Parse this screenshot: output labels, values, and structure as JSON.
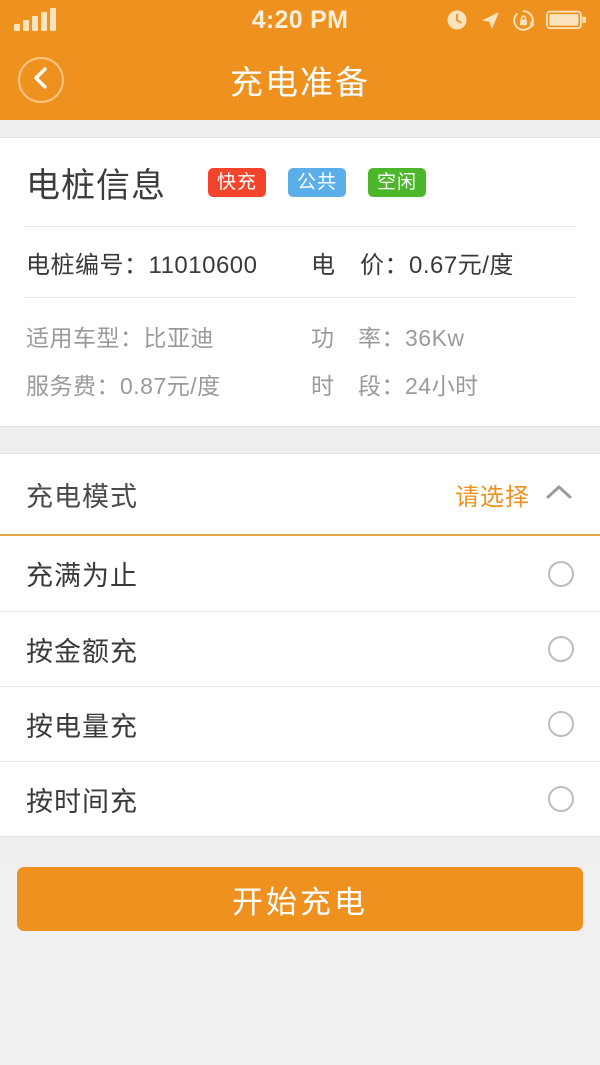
{
  "status_bar": {
    "time": "4:20 PM",
    "signal_icon": "signal-bars-icon",
    "alarm_icon": "alarm-clock-icon",
    "location_icon": "location-arrow-icon",
    "rotation_lock_icon": "rotation-lock-icon",
    "battery_icon": "battery-icon"
  },
  "nav": {
    "back_icon": "chevron-left-icon",
    "title": "充电准备"
  },
  "card": {
    "title": "电桩信息",
    "tags": [
      {
        "label": "快充",
        "color": "#f4452c"
      },
      {
        "label": "公共",
        "color": "#5aaeea"
      },
      {
        "label": "空闲",
        "color": "#4cb72a"
      }
    ],
    "primary_rows": [
      {
        "left": "电桩编号：11010600",
        "right": "电　价：0.67元/度"
      }
    ],
    "secondary_rows": [
      {
        "left": "适用车型：比亚迪",
        "right": "功　率：36Kw"
      },
      {
        "left": "服务费：0.87元/度",
        "right": "时　段：24小时"
      }
    ]
  },
  "mode_section": {
    "label": "充电模式",
    "value": "请选择",
    "chevron_icon": "chevron-up-icon",
    "options": [
      {
        "label": "充满为止",
        "selected": false
      },
      {
        "label": "按金额充",
        "selected": false
      },
      {
        "label": "按电量充",
        "selected": false
      },
      {
        "label": "按时间充",
        "selected": false
      }
    ]
  },
  "action": {
    "start_label": "开始充电"
  },
  "theme": {
    "accent": "#ef911e",
    "page_bg": "#f0f0f0",
    "card_bg": "#ffffff"
  }
}
